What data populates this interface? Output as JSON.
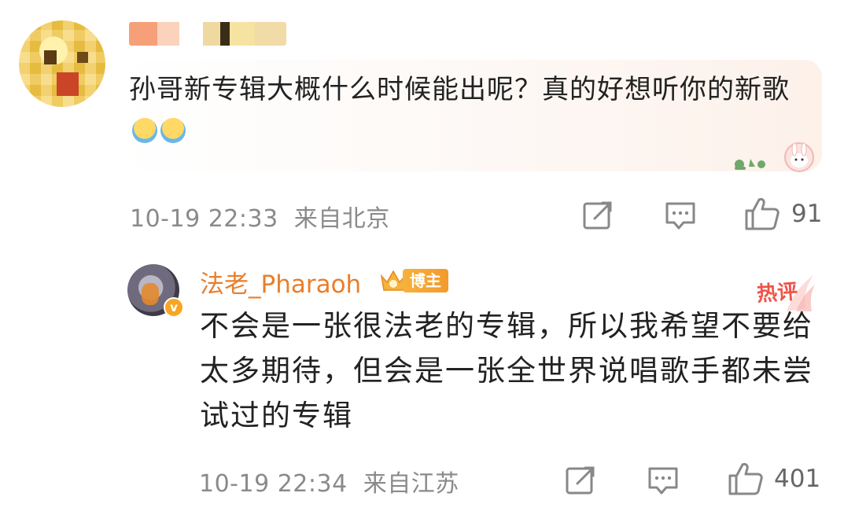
{
  "comment": {
    "text": "孙哥新专辑大概什么时候能出呢？真的好想听你的新歌",
    "emoji": [
      "raising-hand-emoji",
      "raising-hand-emoji"
    ],
    "timestamp": "10-19 22:33",
    "location": "来自北京",
    "likes": "91"
  },
  "reply": {
    "username": "法老_Pharaoh",
    "badge": "博主",
    "verified_mark": "v",
    "hot_label": "热评",
    "text": "不会是一张很法老的专辑，所以我希望不要给太多期待，但会是一张全世界说唱歌手都未尝试过的专辑",
    "timestamp": "10-19 22:34",
    "location": "来自江苏",
    "likes": "401"
  },
  "colors": {
    "username": "#e97e2b",
    "meta_text": "#8a8a8a",
    "hot_label": "#f05248",
    "badge_bg": "#f6a623"
  }
}
